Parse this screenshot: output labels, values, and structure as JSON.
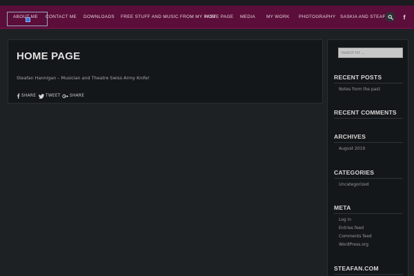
{
  "nav": {
    "items": [
      {
        "label": "About Me"
      },
      {
        "label": "Contact Me"
      },
      {
        "label": "Downloads"
      },
      {
        "label": "Free Stuff and Music from My Past"
      },
      {
        "label": "Home Page"
      },
      {
        "label": "Media"
      },
      {
        "label": "My Work"
      },
      {
        "label": "Photography"
      },
      {
        "label": "Saskia and Steafan"
      }
    ],
    "search_icon": "search-icon",
    "facebook_icon": "facebook-icon",
    "facebook_glyph": "f",
    "accent_color": "#5b0e39"
  },
  "main": {
    "title": "HOME PAGE",
    "description": "Steafan Hannigan – Musician and Theatre Swiss Army Knife!",
    "share": {
      "facebook": "SHARE",
      "twitter": "TWEET",
      "googleplus": "SHARE"
    }
  },
  "sidebar": {
    "search_placeholder": "Search for ...",
    "recent_posts": {
      "title": "RECENT POSTS",
      "items": [
        "Notes from the past"
      ]
    },
    "recent_comments": {
      "title": "RECENT COMMENTS"
    },
    "archives": {
      "title": "ARCHIVES",
      "items": [
        "August 2019"
      ]
    },
    "categories": {
      "title": "CATEGORIES",
      "items": [
        "Uncategorized"
      ]
    },
    "meta": {
      "title": "META",
      "items": [
        "Log in",
        "Entries feed",
        "Comments feed",
        "WordPress.org"
      ]
    },
    "steafan": {
      "title": "STEAFAN.COM"
    }
  }
}
